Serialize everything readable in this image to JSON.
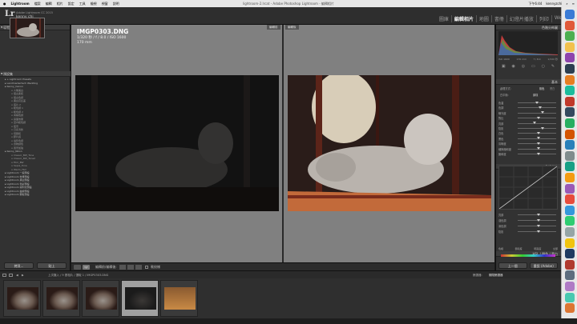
{
  "menubar": {
    "apple": "",
    "items": [
      "Lightroom",
      "檔案",
      "編輯",
      "相片",
      "設定",
      "工具",
      "檢視",
      "視窗",
      "說明"
    ],
    "window_title": "lightroom-2.lrcat - Adobe Photoshop Lightroom - 編輯相片",
    "clock": "下午6:44",
    "user": "kennyzchi"
  },
  "identity": {
    "line1": "Adobe Lightroom CC 2015",
    "line2": "kenny chi",
    "logo": "Lr"
  },
  "modules": [
    "圖庫",
    "編輯相片",
    "地圖",
    "書冊",
    "幻燈片播放",
    "列印",
    "Web"
  ],
  "active_module": "編輯相片",
  "left_panel": {
    "navigator_header": "導覽器",
    "presets_header": "預設集",
    "presets": [
      {
        "label": "+ Lightroom Presets",
        "sub": false
      },
      {
        "label": "Landmarkertech Wedding",
        "sub": false
      },
      {
        "label": "Kenny_Canon",
        "sub": false
      },
      {
        "label": "人像美白",
        "sub": true
      },
      {
        "label": "復古柔和",
        "sub": true
      },
      {
        "label": "復古色調",
        "sub": true
      },
      {
        "label": "黑白高反差",
        "sub": true
      },
      {
        "label": "底片 2",
        "sub": true
      },
      {
        "label": "暖色調 1",
        "sub": true
      },
      {
        "label": "暖色調 2",
        "sub": true
      },
      {
        "label": "青橘色調",
        "sub": true
      },
      {
        "label": "霧面效果",
        "sub": true
      },
      {
        "label": "室內暖色調",
        "sub": true
      },
      {
        "label": "夜景",
        "sub": true
      },
      {
        "label": "日系清新",
        "sub": true
      },
      {
        "label": "低飽和",
        "sub": true
      },
      {
        "label": "膠片感",
        "sub": true
      },
      {
        "label": "電影色調",
        "sub": true
      },
      {
        "label": "食物調色",
        "sub": true
      },
      {
        "label": "風景加強",
        "sub": true
      },
      {
        "label": "Kenny_Nikon",
        "sub": false
      },
      {
        "label": "Classic_BW_Tone",
        "sub": true
      },
      {
        "label": "Classic_BW_Tone2",
        "sub": true
      },
      {
        "label": "Film_BW",
        "sub": true
      },
      {
        "label": "Sepia_Tone",
        "sub": true
      },
      {
        "label": "Warm_Film",
        "sub": true
      },
      {
        "label": "Lightroom 一般預設",
        "sub": false
      },
      {
        "label": "Lightroom 效果預設",
        "sub": false
      },
      {
        "label": "Lightroom 黑白預設",
        "sub": false
      },
      {
        "label": "Lightroom 色彩預設",
        "sub": false
      },
      {
        "label": "Lightroom 銳利化預設",
        "sub": false
      },
      {
        "label": "Lightroom 曲線預設",
        "sub": false
      },
      {
        "label": "Lightroom 顆粒預設",
        "sub": false
      }
    ],
    "copy_button": "拷貝...",
    "paste_button": "貼上"
  },
  "photo": {
    "filename": "IMGP0303.DNG",
    "exposure": "1/320 秒 / f / 8.0 / ISO 1600",
    "focal": "170 mm",
    "before_tag": "編輯前",
    "after_tag": "編輯後"
  },
  "toolbar": {
    "view_label": "編輯前/編輯後:",
    "softproof": "軟校樣"
  },
  "right_panel": {
    "histogram_header": "色階分佈圖",
    "basic_header": "基本",
    "tone_curve_header": "色調曲線",
    "hsl_header": "HSL / 顏色 / 黑白",
    "treatment_color": "彩色",
    "treatment_bw": "黑白",
    "wb_label": "白平衡:",
    "wb_value": "原樣",
    "rows_basic": [
      {
        "label": "色溫",
        "pos": 0.45
      },
      {
        "label": "色調",
        "pos": 0.55
      },
      {
        "label": "曝光度",
        "pos": 0.6
      },
      {
        "label": "對比",
        "pos": 0.5
      },
      {
        "label": "亮部",
        "pos": 0.4
      },
      {
        "label": "陰影",
        "pos": 0.6
      },
      {
        "label": "白色",
        "pos": 0.5
      },
      {
        "label": "黑色",
        "pos": 0.5
      },
      {
        "label": "清晰度",
        "pos": 0.5
      },
      {
        "label": "細節飽和度",
        "pos": 0.5
      },
      {
        "label": "飽和度",
        "pos": 0.5
      }
    ],
    "rows_curve": [
      {
        "label": "亮部",
        "pos": 0.5
      },
      {
        "label": "淺色調",
        "pos": 0.5
      },
      {
        "label": "深色調",
        "pos": 0.5
      },
      {
        "label": "陰影",
        "pos": 0.5
      }
    ],
    "previous_button": "上一個",
    "reset_button": "重設 (Adobe)"
  },
  "filmstrip": {
    "path": "上次匯入 / 9 張相片 / 選取 1 / IMGP0303.DNG",
    "filter_label": "篩選器:",
    "filter_value": "關閉篩選器",
    "thumbnails": 5,
    "selected_index": 3
  }
}
